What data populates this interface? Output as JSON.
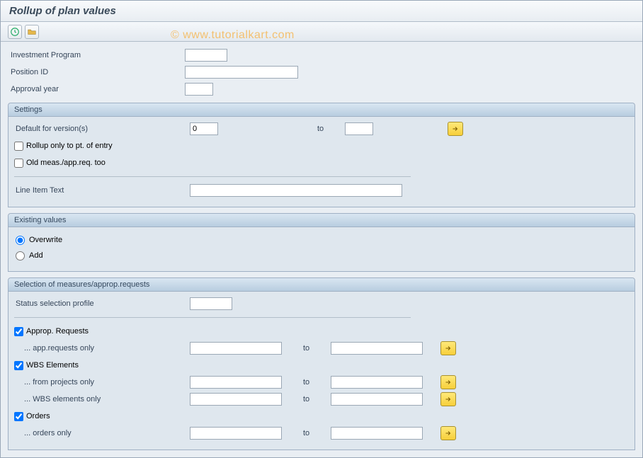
{
  "header": {
    "title": "Rollup of plan values"
  },
  "watermark": "© www.tutorialkart.com",
  "toolbar": {
    "execute_title": "Execute",
    "variant_title": "Get Variant"
  },
  "top_fields": {
    "investment_program": {
      "label": "Investment Program",
      "value": ""
    },
    "position_id": {
      "label": "Position ID",
      "value": ""
    },
    "approval_year": {
      "label": "Approval year",
      "value": ""
    }
  },
  "settings": {
    "title": "Settings",
    "default_version": {
      "label": "Default for version(s)",
      "from": "0",
      "to_label": "to",
      "to": ""
    },
    "rollup_pt_entry": {
      "label": "Rollup only to pt. of entry",
      "checked": false
    },
    "old_meas": {
      "label": "Old meas./app.req. too",
      "checked": false
    },
    "line_item_text": {
      "label": "Line Item Text",
      "value": ""
    }
  },
  "existing": {
    "title": "Existing values",
    "overwrite": {
      "label": "Overwrite"
    },
    "add": {
      "label": "Add"
    },
    "selected": "overwrite"
  },
  "selection": {
    "title": "Selection of measures/approp.requests",
    "status_profile": {
      "label": "Status selection profile",
      "value": ""
    },
    "approp_req": {
      "label": "Approp. Requests",
      "checked": true
    },
    "app_req_only": {
      "label": "... app.requests only",
      "from": "",
      "to_label": "to",
      "to": ""
    },
    "wbs_elements": {
      "label": "WBS Elements",
      "checked": true
    },
    "from_projects": {
      "label": "... from projects only",
      "from": "",
      "to_label": "to",
      "to": ""
    },
    "wbs_only": {
      "label": "... WBS elements only",
      "from": "",
      "to_label": "to",
      "to": ""
    },
    "orders": {
      "label": "Orders",
      "checked": true
    },
    "orders_only": {
      "label": "... orders only",
      "from": "",
      "to_label": "to",
      "to": ""
    }
  }
}
